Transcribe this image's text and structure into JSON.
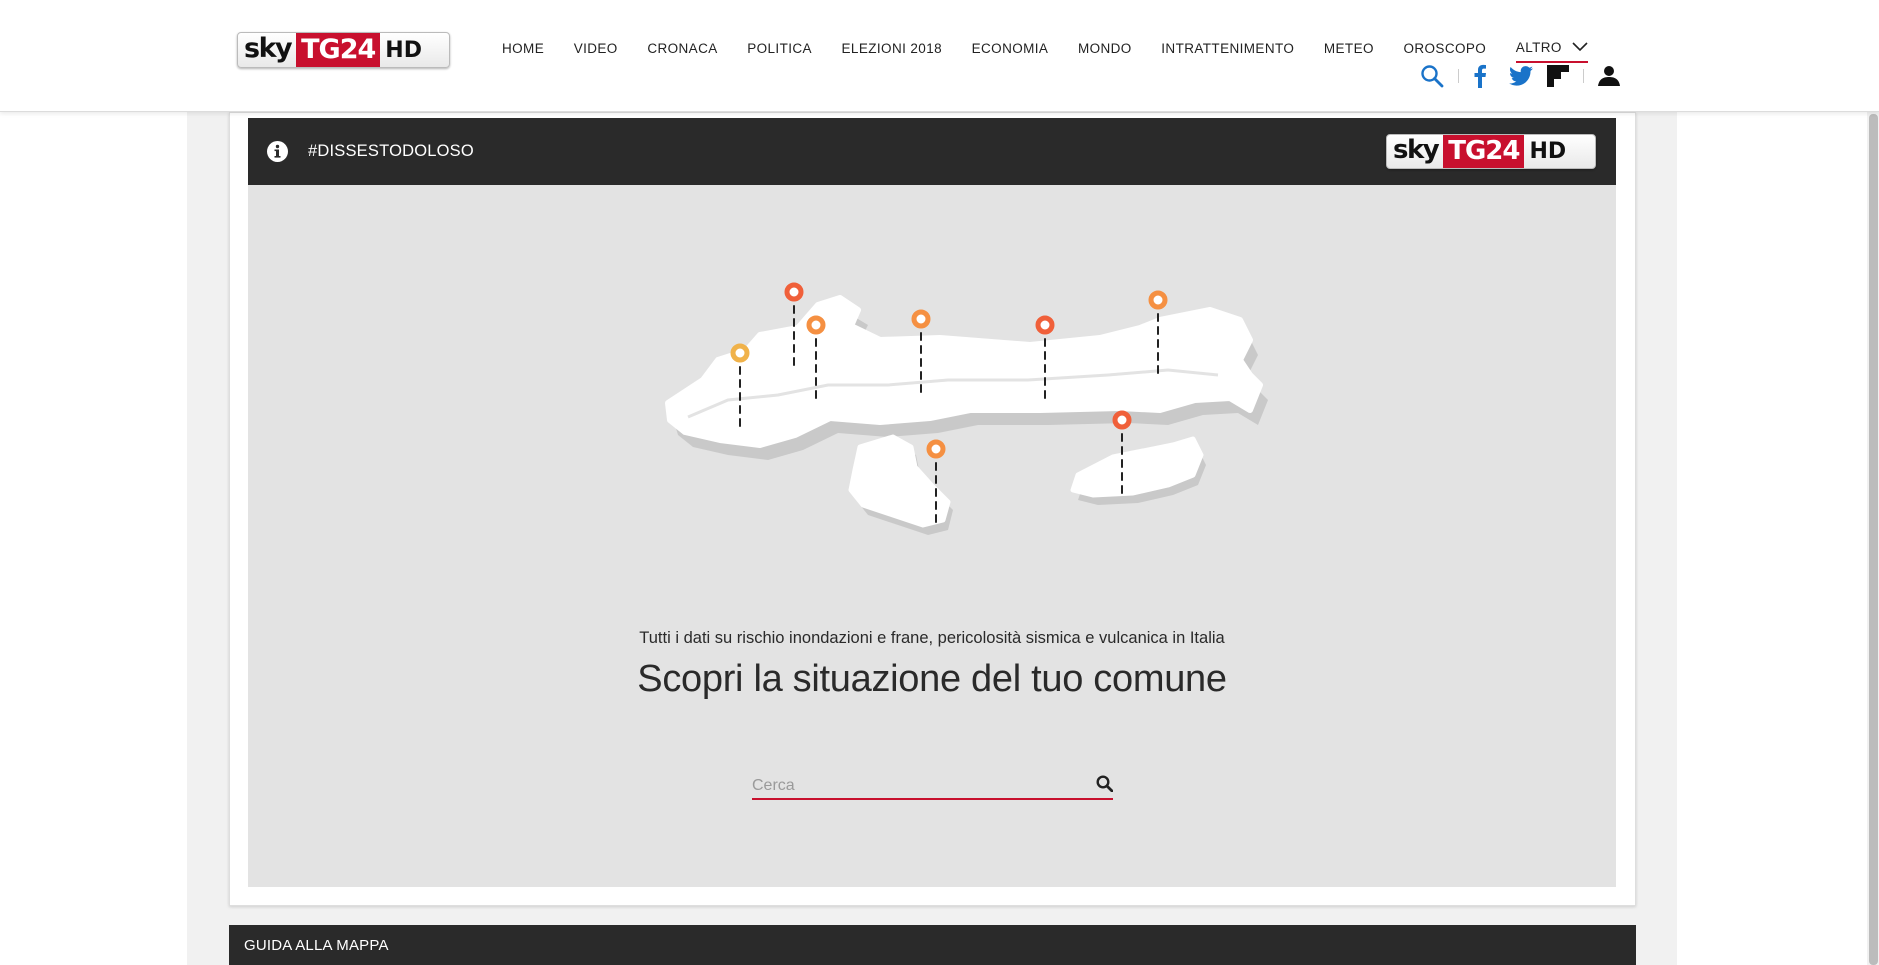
{
  "brand": {
    "logo_text_sky": "sky",
    "logo_text_tg": "TG24",
    "logo_text_hd": "HD",
    "accent": "#c8102e"
  },
  "nav": {
    "items": [
      {
        "label": "HOME"
      },
      {
        "label": "VIDEO"
      },
      {
        "label": "CRONACA"
      },
      {
        "label": "POLITICA"
      },
      {
        "label": "ELEZIONI 2018"
      },
      {
        "label": "ECONOMIA"
      },
      {
        "label": "MONDO"
      },
      {
        "label": "INTRATTENIMENTO"
      },
      {
        "label": "METEO"
      },
      {
        "label": "OROSCOPO"
      },
      {
        "label": "ALTRO"
      }
    ]
  },
  "tools": {
    "icons": [
      "search-icon",
      "facebook-icon",
      "twitter-icon",
      "flipboard-icon",
      "user-icon"
    ]
  },
  "widget": {
    "hashtag": "#DISSESTODOLOSO",
    "subtitle": "Tutti i dati su rischio inondazioni e frane, pericolosità sismica e vulcanica in Italia",
    "title": "Scopri la situazione del tuo comune",
    "search": {
      "placeholder": "Cerca",
      "value": ""
    },
    "pin_colors": [
      "#f0b24a",
      "#f59042",
      "#f0603a"
    ]
  },
  "footer_bar": {
    "label": "GUIDA ALLA MAPPA"
  }
}
